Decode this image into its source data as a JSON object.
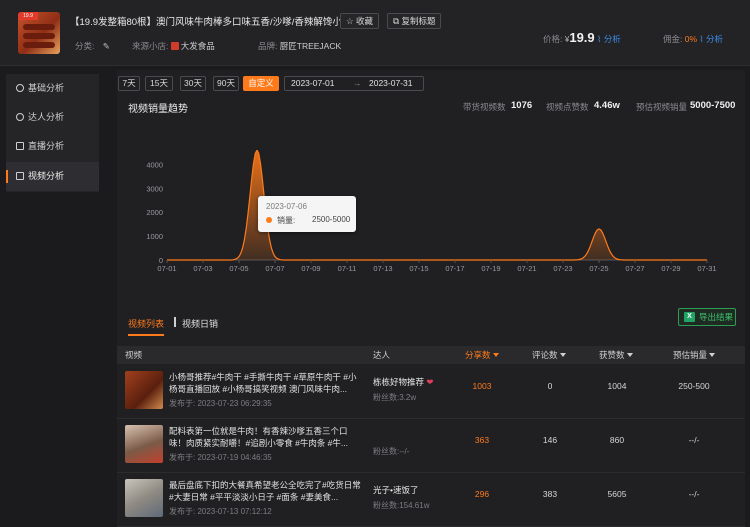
{
  "product": {
    "title": "【19.9发整箱80根】澳门风味牛肉棒多口味五香/沙嗲/香辣解馋小...",
    "favorite_label": "收藏",
    "copy_title_label": "复制标题",
    "category_label": "分类:",
    "shop_label": "来源小店:",
    "shop_value": "大发食品",
    "brand_label": "品牌:",
    "brand_value": "厨匠TREEJACK",
    "price_label": "价格:",
    "price_currency": "¥",
    "price_value": "19.9",
    "price_analysis": "分析",
    "commission_label": "佣金:",
    "commission_value": "0%",
    "commission_analysis": "分析",
    "thumb_badge": "19.9"
  },
  "sidebar": {
    "items": [
      {
        "label": "基础分析",
        "icon": "chart-circle-icon",
        "active": false
      },
      {
        "label": "达人分析",
        "icon": "user-icon",
        "active": false
      },
      {
        "label": "直播分析",
        "icon": "live-icon",
        "active": false
      },
      {
        "label": "视频分析",
        "icon": "video-icon",
        "active": true
      }
    ]
  },
  "filters": {
    "ranges": [
      "7天",
      "15天",
      "30天",
      "90天",
      "自定义"
    ],
    "active_range": "自定义",
    "date_start": "2023-07-01",
    "date_sep": "→",
    "date_end": "2023-07-31"
  },
  "stats": {
    "chart_title": "视频销量趋势",
    "video_count_label": "带货视频数",
    "video_count": "1076",
    "likes_label": "视频点赞数",
    "likes": "4.46w",
    "sales_label": "预估视频销量",
    "sales": "5000-7500"
  },
  "chart_data": {
    "type": "area",
    "title": "视频销量趋势",
    "x": [
      "07-01",
      "07-02",
      "07-03",
      "07-04",
      "07-05",
      "07-06",
      "07-07",
      "07-08",
      "07-09",
      "07-10",
      "07-11",
      "07-12",
      "07-13",
      "07-14",
      "07-15",
      "07-16",
      "07-17",
      "07-18",
      "07-19",
      "07-20",
      "07-21",
      "07-22",
      "07-23",
      "07-24",
      "07-25",
      "07-26",
      "07-27",
      "07-28",
      "07-29",
      "07-30",
      "07-31"
    ],
    "xticks": [
      "07-01",
      "07-03",
      "07-05",
      "07-07",
      "07-09",
      "07-11",
      "07-13",
      "07-15",
      "07-17",
      "07-19",
      "07-21",
      "07-23",
      "07-25",
      "07-27",
      "07-29",
      "07-31"
    ],
    "series": [
      {
        "values": [
          0,
          0,
          0,
          0,
          0,
          4600,
          0,
          0,
          0,
          0,
          0,
          0,
          0,
          0,
          0,
          0,
          0,
          0,
          0,
          0,
          0,
          0,
          0,
          0,
          1300,
          0,
          0,
          0,
          0,
          0,
          0
        ]
      }
    ],
    "yticks": [
      "0",
      "1000",
      "2000",
      "3000",
      "4000"
    ],
    "ylim": [
      0,
      4600
    ],
    "color": "#ff7a1a",
    "tooltip": {
      "date": "2023-07-06",
      "label": "销量:",
      "value": "2500-5000"
    }
  },
  "tabs": {
    "video_list": "视频列表",
    "video_daily": "视频日销",
    "export": "导出结果"
  },
  "table": {
    "headers": {
      "video": "视频",
      "influencer": "达人",
      "fans": "分享数",
      "comments": "评论数",
      "likes": "获赞数",
      "sales": "预估销量"
    },
    "rows": [
      {
        "text": "小杨哥推荐#牛肉干 #手撕牛肉干 #草原牛肉干 #小杨哥直播回放 #小杨哥搞笑视频 澳门风味牛肉...",
        "date": "发布于: 2023-07-23 06:29:35",
        "influencer": "栋栋好物推荐",
        "fans": "粉丝数:3.2w",
        "shares": "1003",
        "comments": "0",
        "likes": "1004",
        "sales": "250-500"
      },
      {
        "text": "配料表第一位就是牛肉！有香辣沙嗲五香三个口味！肉质紧实耐嚼！#追剧小零食 #牛肉条 #牛...",
        "date": "发布于: 2023-07-19 04:46:35",
        "influencer": "",
        "fans": "粉丝数:--/-",
        "shares": "363",
        "comments": "146",
        "likes": "860",
        "sales": "--/-"
      },
      {
        "text": "最后盘底下扣的大餐真希望老公全吃完了#吃货日常 #大妻日常 #平平淡淡小日子 #面条 #妻美食...",
        "date": "发布于: 2023-07-13 07:12:12",
        "influencer": "光子•速饭了",
        "fans": "粉丝数:154.61w",
        "shares": "296",
        "comments": "383",
        "likes": "5605",
        "sales": "--/-"
      }
    ]
  }
}
